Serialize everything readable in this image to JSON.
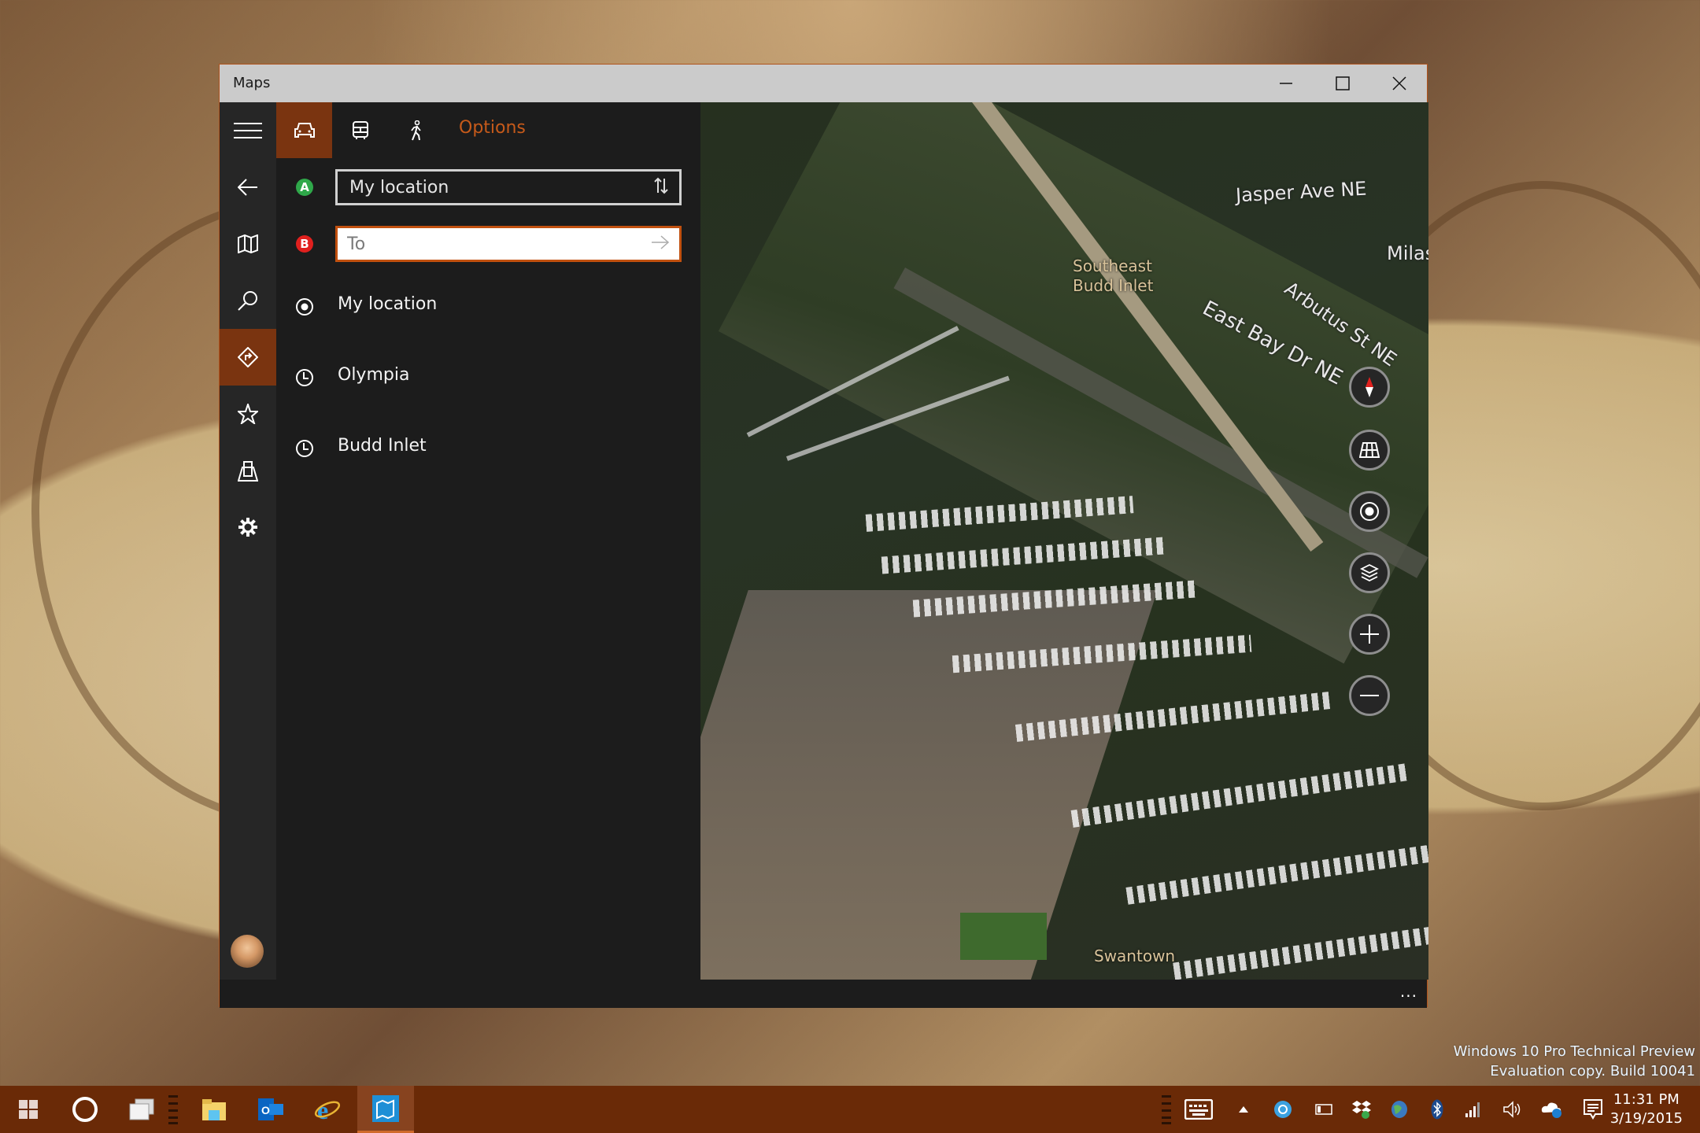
{
  "desktop": {
    "watermark_line1": "Windows 10 Pro Technical Preview",
    "watermark_line2": "Evaluation copy. Build 10041"
  },
  "window": {
    "title": "Maps",
    "controls": [
      "minimize-icon",
      "maximize-icon",
      "close-icon"
    ]
  },
  "nav_rail": {
    "items": [
      {
        "icon": "hamburger-menu-icon",
        "label": "Menu"
      },
      {
        "icon": "back-arrow-icon",
        "label": "Back"
      },
      {
        "icon": "map-icon",
        "label": "Map"
      },
      {
        "icon": "search-icon",
        "label": "Search"
      },
      {
        "icon": "directions-icon",
        "label": "Directions",
        "active": true
      },
      {
        "icon": "star-icon",
        "label": "Favorites"
      },
      {
        "icon": "3d-cities-icon",
        "label": "3D Cities"
      },
      {
        "icon": "gear-icon",
        "label": "Settings"
      }
    ],
    "avatar": "user-avatar"
  },
  "directions": {
    "modes": [
      {
        "icon": "car-icon",
        "label": "Drive",
        "active": true
      },
      {
        "icon": "bus-icon",
        "label": "Transit"
      },
      {
        "icon": "walk-icon",
        "label": "Walk"
      }
    ],
    "options_label": "Options",
    "from": {
      "badge": "A",
      "value": "My location",
      "swap_icon": "swap-icon"
    },
    "to": {
      "badge": "B",
      "value": "",
      "placeholder": "To",
      "go_icon": "arrow-right-icon"
    },
    "suggestions": [
      {
        "icon": "my-location-icon",
        "label": "My location"
      },
      {
        "icon": "clock-icon",
        "label": "Olympia"
      },
      {
        "icon": "clock-icon",
        "label": "Budd Inlet"
      }
    ]
  },
  "map": {
    "labels": {
      "area": "Southeast\nBudd Inlet",
      "neighborhood": "Swantown",
      "streets": [
        "Jasper Ave NE",
        "Arbutus St NE",
        "East Bay Dr NE",
        "Milas"
      ]
    },
    "controls": [
      {
        "icon": "compass-icon",
        "label": "Compass"
      },
      {
        "icon": "tilt-icon",
        "label": "Tilt"
      },
      {
        "icon": "locate-icon",
        "label": "Show my location"
      },
      {
        "icon": "layers-icon",
        "label": "Map views"
      },
      {
        "icon": "zoom-in-icon",
        "label": "Zoom in"
      },
      {
        "icon": "zoom-out-icon",
        "label": "Zoom out"
      }
    ]
  },
  "appbar": {
    "more_label": "..."
  },
  "taskbar": {
    "pinned": [
      "start-icon",
      "cortana-icon",
      "task-view-icon",
      "file-explorer-icon",
      "outlook-icon",
      "internet-explorer-icon",
      "maps-app-icon"
    ],
    "tray": [
      "touch-keyboard-icon",
      "show-hidden-icons",
      "creative-cloud-icon",
      "battery-icon",
      "dropbox-icon",
      "network-globe-icon",
      "bluetooth-icon",
      "signal-icon",
      "volume-icon",
      "onedrive-icon",
      "action-center-icon"
    ],
    "time": "11:31 PM",
    "date": "3/19/2015",
    "colors": {
      "background": "#6a2a07",
      "accent": "#c1500f"
    }
  },
  "colors": {
    "accent": "#c1500f",
    "active_bg": "#7a3410",
    "pin_a": "#2fa84a",
    "pin_b": "#e0201e"
  }
}
